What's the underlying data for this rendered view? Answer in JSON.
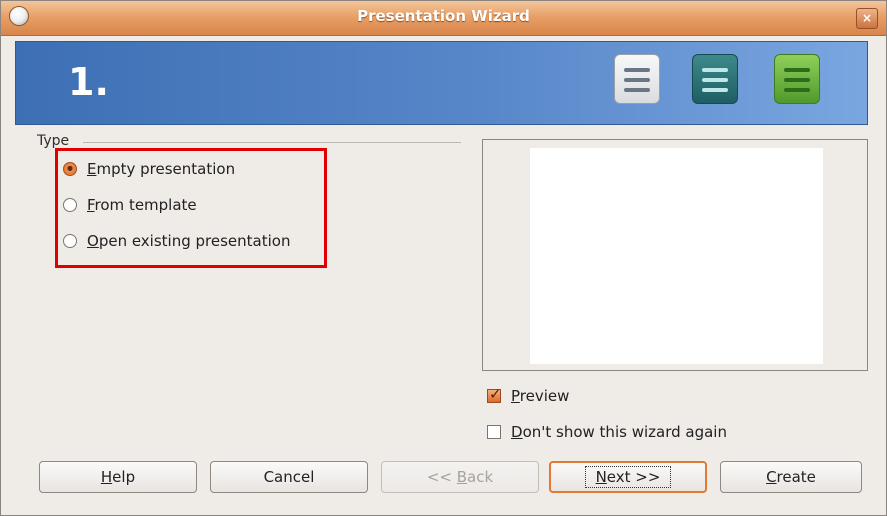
{
  "window": {
    "title": "Presentation Wizard",
    "close_glyph": "×"
  },
  "banner": {
    "step": "1."
  },
  "type_group": {
    "label": "Type",
    "options": [
      {
        "mnemonic": "E",
        "rest": "mpty presentation",
        "selected": true
      },
      {
        "mnemonic": "F",
        "rest": "rom template",
        "selected": false
      },
      {
        "mnemonic": "O",
        "rest": "pen existing presentation",
        "selected": false
      }
    ]
  },
  "preview_checkbox": {
    "mnemonic": "P",
    "rest": "review",
    "checked": true
  },
  "dont_show_checkbox": {
    "mnemonic": "D",
    "rest": "on't show this wizard again",
    "checked": false
  },
  "buttons": {
    "help": {
      "mnemonic": "H",
      "rest": "elp"
    },
    "cancel": {
      "label": "Cancel"
    },
    "back": {
      "prefix": "<< ",
      "mnemonic": "B",
      "rest": "ack"
    },
    "next": {
      "mnemonic": "N",
      "rest": "ext >>"
    },
    "create": {
      "mnemonic": "C",
      "rest": "reate"
    }
  },
  "colors": {
    "titlebar": "#e8a067",
    "banner": "#5887c9",
    "highlight_box": "#e00000",
    "accent": "#e07a35"
  }
}
